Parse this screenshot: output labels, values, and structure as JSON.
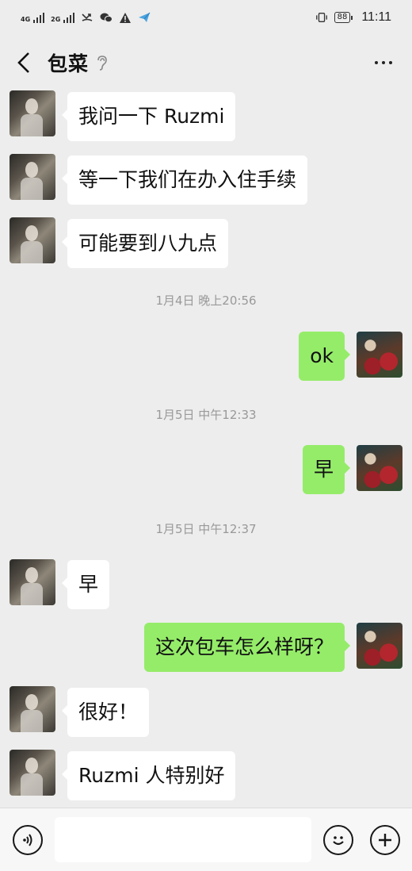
{
  "status_bar": {
    "sim1_label": "4G",
    "sim2_label": "2G",
    "battery": "88",
    "time": "11:11"
  },
  "header": {
    "title": "包菜"
  },
  "messages": [
    {
      "type": "peer",
      "text": "我问一下 Ruzmi"
    },
    {
      "type": "peer",
      "text": "等一下我们在办入住手续"
    },
    {
      "type": "peer",
      "text": "可能要到八九点"
    },
    {
      "type": "time",
      "text": "1月4日 晚上20:56"
    },
    {
      "type": "me",
      "text": "ok"
    },
    {
      "type": "time",
      "text": "1月5日 中午12:33"
    },
    {
      "type": "me",
      "text": "早"
    },
    {
      "type": "time",
      "text": "1月5日 中午12:37"
    },
    {
      "type": "peer",
      "text": "早"
    },
    {
      "type": "me",
      "text": "这次包车怎么样呀？"
    },
    {
      "type": "peer",
      "text": "很好！"
    },
    {
      "type": "peer",
      "text": "Ruzmi 人特别好"
    }
  ],
  "input": {
    "value": ""
  },
  "colors": {
    "background": "#ededed",
    "peer_bubble": "#ffffff",
    "my_bubble": "#95ec69",
    "timestamp": "#999999"
  },
  "icons": {
    "back": "chevron-left-icon",
    "ear": "ear-icon",
    "more": "more-dots-icon",
    "voice": "voice-icon",
    "emoji": "emoji-icon",
    "add": "plus-icon"
  }
}
